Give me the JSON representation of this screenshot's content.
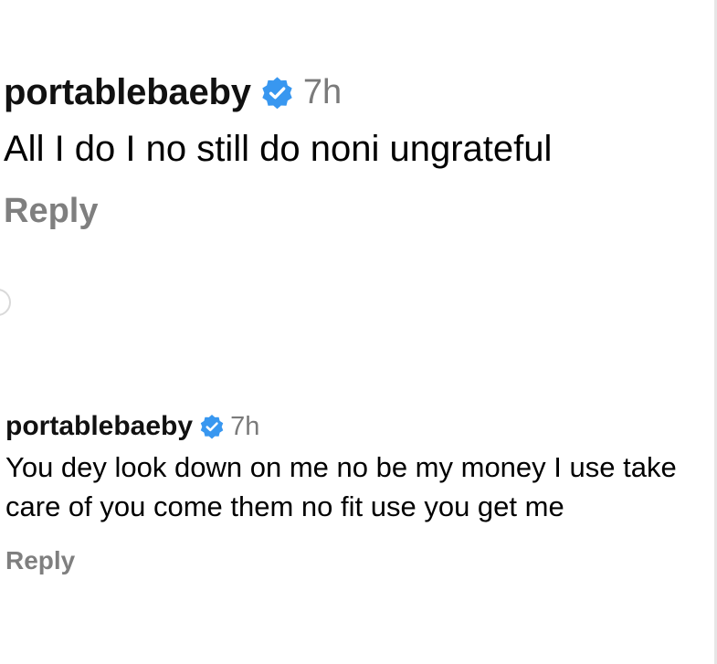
{
  "comments": [
    {
      "username": "portablebaeby",
      "verified": true,
      "time": "7h",
      "text": "All I do I no still do noni ungrateful",
      "reply_label": "Reply"
    },
    {
      "username": "portablebaeby",
      "verified": true,
      "time": "7h",
      "text": "You dey look down on me no be my money I use take care of you come them no fit use you get me",
      "reply_label": "Reply"
    }
  ],
  "colors": {
    "verified_badge": "#3897f0",
    "timestamp": "#7a7a7a",
    "reply": "#7f7f7f"
  }
}
